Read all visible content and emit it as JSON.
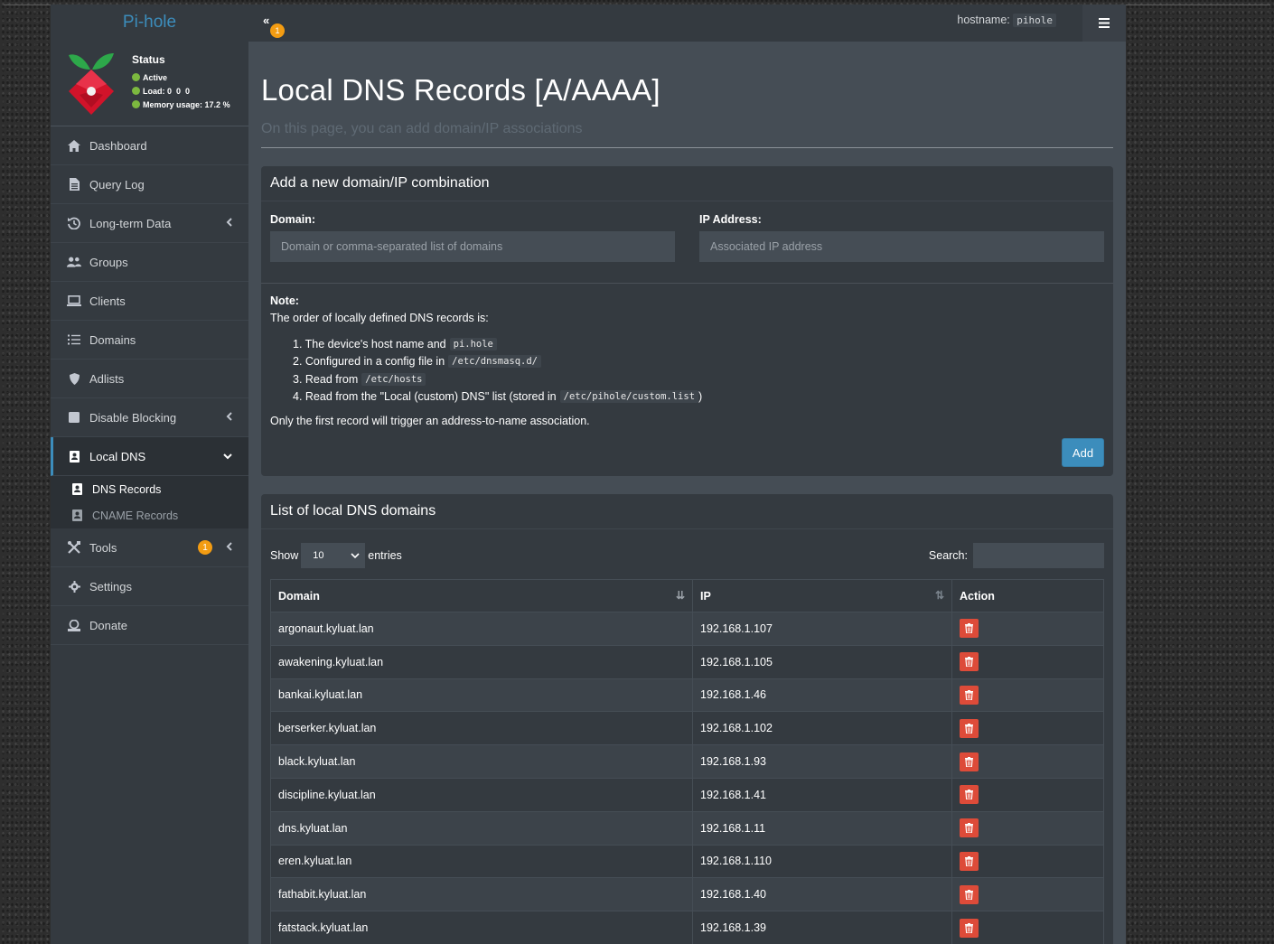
{
  "brand": {
    "prefix": "Pi-",
    "suffix": "hole"
  },
  "status": {
    "title": "Status",
    "active": "Active",
    "load_label": "Load:",
    "load_values": "0  0  0",
    "memory_label": "Memory usage:",
    "memory_value": "17.2 %"
  },
  "sidebar": {
    "items": [
      {
        "label": "Dashboard"
      },
      {
        "label": "Query Log"
      },
      {
        "label": "Long-term Data"
      },
      {
        "label": "Groups"
      },
      {
        "label": "Clients"
      },
      {
        "label": "Domains"
      },
      {
        "label": "Adlists"
      },
      {
        "label": "Disable Blocking"
      },
      {
        "label": "Local DNS"
      },
      {
        "label": "Tools",
        "badge": "1"
      },
      {
        "label": "Settings"
      },
      {
        "label": "Donate"
      }
    ],
    "sub_items": [
      {
        "label": "DNS Records"
      },
      {
        "label": "CNAME Records"
      }
    ]
  },
  "header": {
    "toggle_icon": "«",
    "badge": "1",
    "hostname_label": "hostname:",
    "hostname_value": "pihole",
    "menu_icon": "≡"
  },
  "page": {
    "title": "Local DNS Records [A/AAAA]",
    "subtitle": "On this page, you can add domain/IP associations"
  },
  "add_card": {
    "title": "Add a new domain/IP combination",
    "domain_label": "Domain:",
    "domain_placeholder": "Domain or comma-separated list of domains",
    "ip_label": "IP Address:",
    "ip_placeholder": "Associated IP address",
    "note_title": "Note:",
    "note_text": "The order of locally defined DNS records is:",
    "note_list": [
      {
        "text": "1. The device's host name and",
        "code": "pi.hole",
        "after": ""
      },
      {
        "text": "2. Configured in a config file in",
        "code": "/etc/dnsmasq.d/",
        "after": ""
      },
      {
        "text": "3. Read from",
        "code": "/etc/hosts",
        "after": ""
      },
      {
        "text": "4. Read from the \"Local (custom) DNS\" list (stored in",
        "code": "/etc/pihole/custom.list",
        "after": ")"
      }
    ],
    "note_last": "Only the first record will trigger an address-to-name association.",
    "add_label": "Add"
  },
  "list_card": {
    "title": "List of local DNS domains",
    "show_label": "Show",
    "entries_value": "10",
    "entries_label": "entries",
    "search_label": "Search:",
    "columns": [
      "Domain",
      "IP",
      "Action"
    ],
    "rows": [
      {
        "domain": "argonaut.kyluat.lan",
        "ip": "192.168.1.107"
      },
      {
        "domain": "awakening.kyluat.lan",
        "ip": "192.168.1.105"
      },
      {
        "domain": "bankai.kyluat.lan",
        "ip": "192.168.1.46"
      },
      {
        "domain": "berserker.kyluat.lan",
        "ip": "192.168.1.102"
      },
      {
        "domain": "black.kyluat.lan",
        "ip": "192.168.1.93"
      },
      {
        "domain": "discipline.kyluat.lan",
        "ip": "192.168.1.41"
      },
      {
        "domain": "dns.kyluat.lan",
        "ip": "192.168.1.11"
      },
      {
        "domain": "eren.kyluat.lan",
        "ip": "192.168.1.110"
      },
      {
        "domain": "fathabit.kyluat.lan",
        "ip": "192.168.1.40"
      },
      {
        "domain": "fatstack.kyluat.lan",
        "ip": "192.168.1.39"
      }
    ]
  },
  "colors": {
    "accent": "#3c8dbc",
    "danger": "#dd4b39",
    "warning": "#f39c12",
    "status_ok": "#7cb83f"
  }
}
